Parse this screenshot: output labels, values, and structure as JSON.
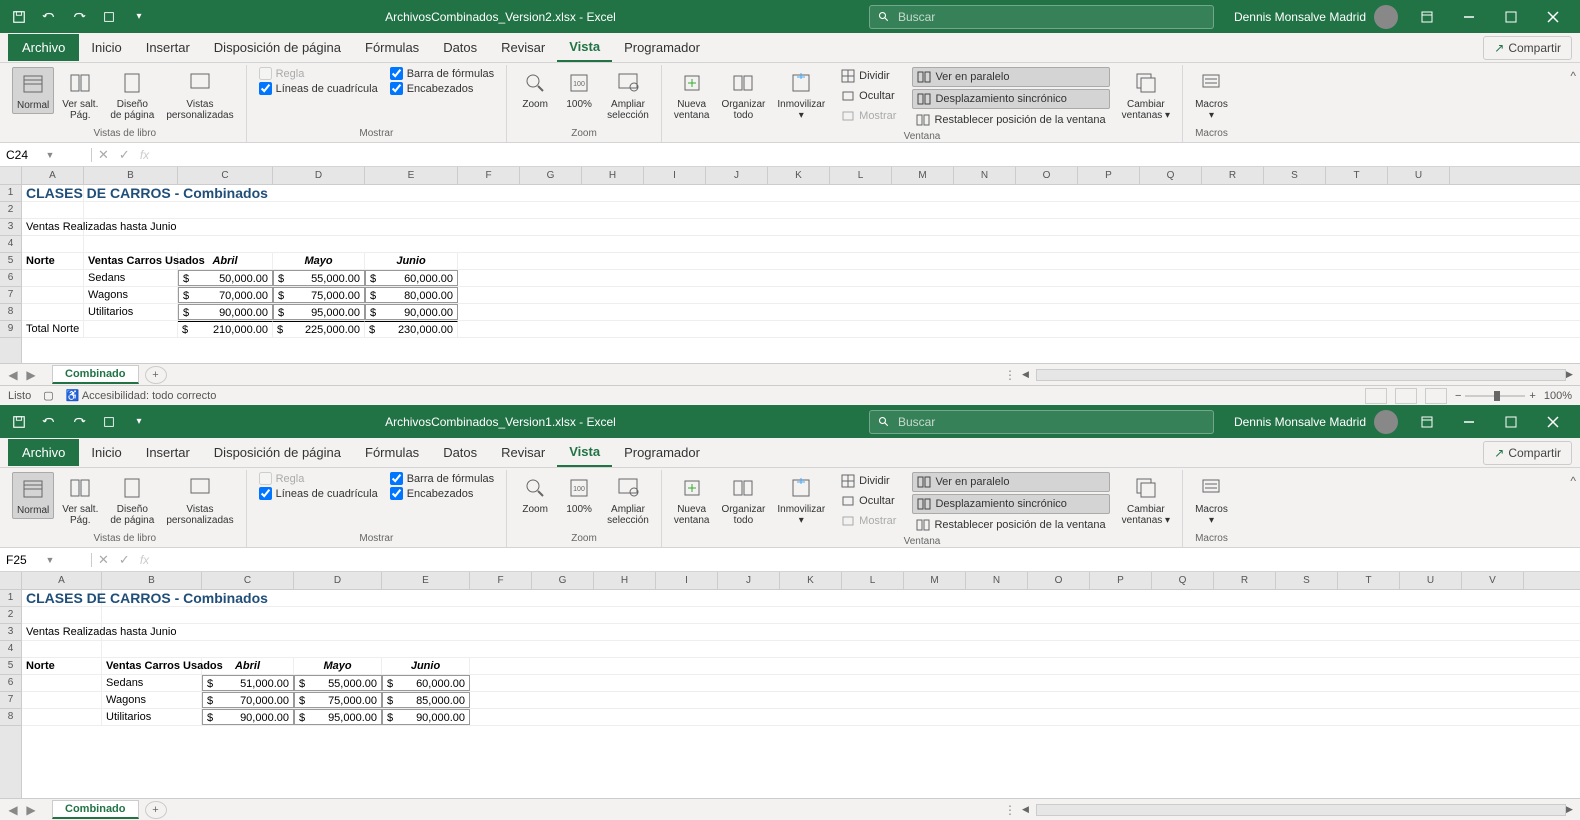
{
  "app": {
    "title1": "ArchivosCombinados_Version2.xlsx  -  Excel",
    "title2": "ArchivosCombinados_Version1.xlsx  -  Excel",
    "search_placeholder": "Buscar",
    "user": "Dennis Monsalve Madrid",
    "share": "Compartir"
  },
  "menu": {
    "archivo": "Archivo",
    "inicio": "Inicio",
    "insertar": "Insertar",
    "disposicion": "Disposición de página",
    "formulas": "Fórmulas",
    "datos": "Datos",
    "revisar": "Revisar",
    "vista": "Vista",
    "programador": "Programador"
  },
  "ribbon": {
    "vistas_libro": "Vistas de libro",
    "mostrar": "Mostrar",
    "zoom_group": "Zoom",
    "ventana": "Ventana",
    "macros_group": "Macros",
    "normal": "Normal",
    "ver_salt": "Ver salt.\nPág.",
    "diseno": "Diseño\nde página",
    "vistas_pers": "Vistas\npersonalizadas",
    "regla": "Regla",
    "cuadricula": "Líneas de cuadrícula",
    "barra_formulas": "Barra de fórmulas",
    "encabezados": "Encabezados",
    "zoom": "Zoom",
    "cien": "100%",
    "ampliar": "Ampliar\nselección",
    "nueva_ventana": "Nueva\nventana",
    "organizar": "Organizar\ntodo",
    "inmovilizar": "Inmovilizar",
    "dividir": "Dividir",
    "ocultar": "Ocultar",
    "mostrar_btn": "Mostrar",
    "paralelo": "Ver en paralelo",
    "desplazamiento": "Desplazamiento sincrónico",
    "restablecer": "Restablecer posición de la ventana",
    "cambiar_ventanas": "Cambiar\nventanas",
    "macros": "Macros"
  },
  "namebox1": "C24",
  "namebox2": "F25",
  "fx_label": "fx",
  "sheet": {
    "tab": "Combinado",
    "cols": [
      "A",
      "B",
      "C",
      "D",
      "E",
      "F",
      "G",
      "H",
      "I",
      "J",
      "K",
      "L",
      "M",
      "N",
      "O",
      "P",
      "Q",
      "R",
      "S",
      "T",
      "U",
      "V"
    ],
    "title": "CLASES DE CARROS - Combinados",
    "subtitle": "Ventas Realizadas hasta Junio",
    "norte": "Norte",
    "ventas_hdr": "Ventas Carros Usados",
    "months": [
      "Abril",
      "Mayo",
      "Junio"
    ],
    "rows1": [
      {
        "name": "Sedans",
        "vals": [
          "50,000.00",
          "55,000.00",
          "60,000.00"
        ]
      },
      {
        "name": "Wagons",
        "vals": [
          "70,000.00",
          "75,000.00",
          "80,000.00"
        ]
      },
      {
        "name": "Utilitarios",
        "vals": [
          "90,000.00",
          "95,000.00",
          "90,000.00"
        ]
      }
    ],
    "total1": {
      "label": "Total Norte",
      "vals": [
        "210,000.00",
        "225,000.00",
        "230,000.00"
      ]
    },
    "rows2": [
      {
        "name": "Sedans",
        "vals": [
          "51,000.00",
          "55,000.00",
          "60,000.00"
        ]
      },
      {
        "name": "Wagons",
        "vals": [
          "70,000.00",
          "75,000.00",
          "85,000.00"
        ]
      },
      {
        "name": "Utilitarios",
        "vals": [
          "90,000.00",
          "95,000.00",
          "90,000.00"
        ]
      }
    ],
    "currency": "$"
  },
  "statusbar": {
    "listo": "Listo",
    "accesibilidad": "Accesibilidad: todo correcto",
    "zoom": "100%"
  }
}
